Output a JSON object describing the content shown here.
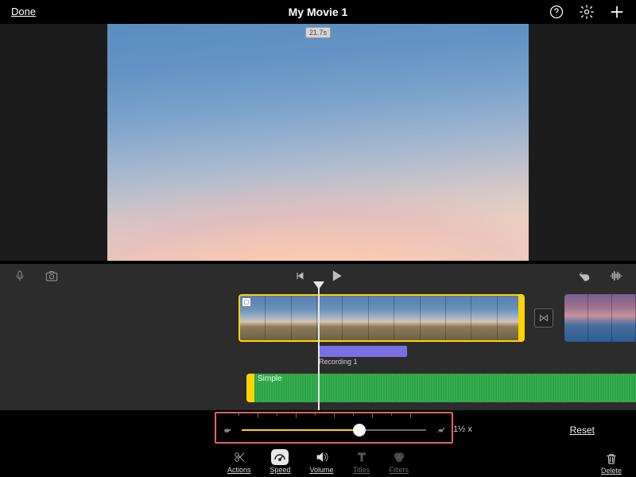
{
  "header": {
    "done": "Done",
    "title": "My Movie 1"
  },
  "preview": {
    "duration_badge": "21.7s"
  },
  "timeline": {
    "audio_label": "Recording 1",
    "music_label": "Simple"
  },
  "speed": {
    "value_label": "1½ x",
    "reset": "Reset",
    "slider_pct": 64
  },
  "toolbar": {
    "actions": "Actions",
    "speed": "Speed",
    "volume": "Volume",
    "titles": "Titles",
    "filters": "Filters",
    "delete": "Delete"
  }
}
